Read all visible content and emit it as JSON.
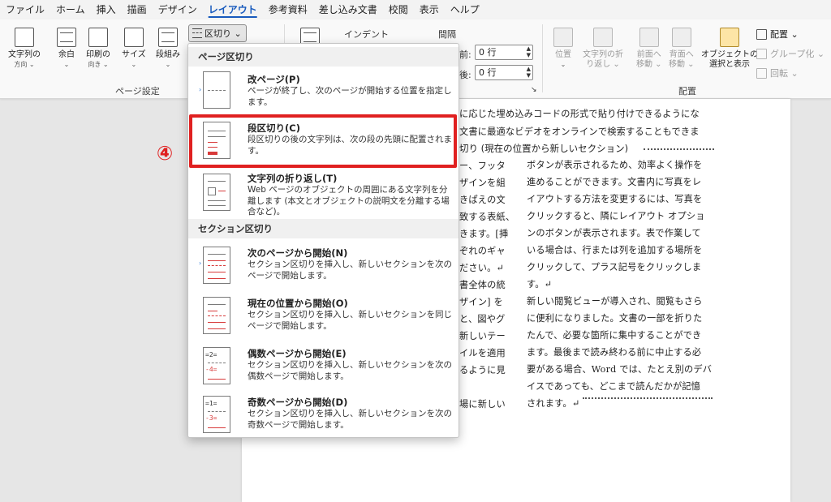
{
  "menu": {
    "tabs": [
      "ファイル",
      "ホーム",
      "挿入",
      "描画",
      "デザイン",
      "レイアウト",
      "参考資料",
      "差し込み文書",
      "校閲",
      "表示",
      "ヘルプ"
    ],
    "active_tab": "レイアウト"
  },
  "ribbon": {
    "page_setup": {
      "buttons": [
        {
          "line1": "文字列の",
          "line2": "方向 ⌄"
        },
        {
          "line1": "余白",
          "line2": "⌄"
        },
        {
          "line1": "印刷の",
          "line2": "向き ⌄"
        },
        {
          "line1": "サイズ",
          "line2": "⌄"
        },
        {
          "line1": "段組み",
          "line2": "⌄"
        }
      ],
      "group_label": "ページ設定"
    },
    "breaks_button": "区切り ⌄",
    "indent_label": "インデント",
    "spacing_label": "間隔",
    "spacing_before_label": "前:",
    "spacing_before_value": "0 行",
    "spacing_after_label": "後:",
    "spacing_after_value": "0 行",
    "arrange": {
      "buttons": [
        {
          "line1": "位置",
          "line2": "⌄"
        },
        {
          "line1": "文字列の折",
          "line2": "り返し ⌄"
        },
        {
          "line1": "前面へ",
          "line2": "移動 ⌄"
        },
        {
          "line1": "背面へ",
          "line2": "移動 ⌄"
        },
        {
          "line1": "オブジェクトの",
          "line2": "選択と表示"
        }
      ],
      "side": [
        "配置 ⌄",
        "グループ化 ⌄",
        "回転 ⌄"
      ],
      "group_label": "配置"
    }
  },
  "dropdown": {
    "section1": "ページ区切り",
    "section2": "セクション区切り",
    "items": [
      {
        "title": "改ページ(P)",
        "desc": "ページが終了し、次のページが開始する位置を指定します。"
      },
      {
        "title": "段区切り(C)",
        "desc": "段区切りの後の文字列は、次の段の先頭に配置されます。"
      },
      {
        "title": "文字列の折り返し(T)",
        "desc": "Web ページのオブジェクトの周囲にある文字列を分離します (本文とオブジェクトの説明文を分離する場合など)。"
      },
      {
        "title": "次のページから開始(N)",
        "desc": "セクション区切りを挿入し、新しいセクションを次のページで開始します。"
      },
      {
        "title": "現在の位置から開始(O)",
        "desc": "セクション区切りを挿入し、新しいセクションを同じページで開始します。"
      },
      {
        "title": "偶数ページから開始(E)",
        "desc": "セクション区切りを挿入し、新しいセクションを次の偶数ページで開始します。"
      },
      {
        "title": "奇数ページから開始(D)",
        "desc": "セクション区切りを挿入し、新しいセクションを次の奇数ページで開始します。"
      }
    ]
  },
  "step_label": "④",
  "document": {
    "top_lines": [
      "に応じた埋め込みコードの形式で貼り付けできるようにな",
      "文書に最適なビデオをオンラインで検索することもできま"
    ],
    "heading": "切り (現在の位置から新しいセクション)",
    "left_col": [
      "ー、フッタ",
      "ザインを組",
      "きぱえの文",
      "致する表紙、",
      "きます。[挿",
      "ぞれのギャ",
      "ださい。↵",
      "書全体の統",
      "ザイン] を",
      "と、図やグ",
      "新しいテー",
      "イルを適用",
      "るように見",
      "",
      "場に新しい"
    ],
    "right_col": [
      "ボタンが表示されるため、効率よく操作を",
      "進めることができます。文書内に写真をレ",
      "イアウトする方法を変更するには、写真を",
      "クリックすると、隣にレイアウト オプショ",
      "ンのボタンが表示されます。表で作業して",
      "いる場合は、行または列を追加する場所を",
      "クリックして、プラス記号をクリックしま",
      "す。↵",
      "新しい閲覧ビューが導入され、閲覧もさら",
      "に便利になりました。文書の一部を折りた",
      "たんで、必要な箇所に集中することができ",
      "ます。最後まで読み終わる前に中止する必",
      "要がある場合、Word では、たとえ別のデバ",
      "イスであっても、どこまで読んだかが記憶",
      "されます。↵"
    ]
  }
}
